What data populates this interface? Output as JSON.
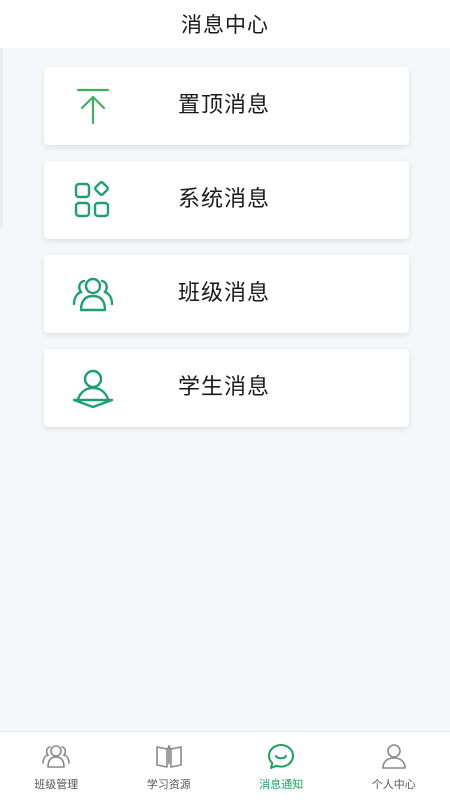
{
  "header": {
    "title": "消息中心"
  },
  "theme": {
    "accent": "#1aa35d",
    "icon_green": "#23a86a",
    "inactive": "#8a8a8a"
  },
  "messages": [
    {
      "label": "置顶消息",
      "icon": "pin-top-icon"
    },
    {
      "label": "系统消息",
      "icon": "apps-grid-icon"
    },
    {
      "label": "班级消息",
      "icon": "group-icon"
    },
    {
      "label": "学生消息",
      "icon": "student-icon"
    }
  ],
  "tabbar": {
    "active_index": 2,
    "items": [
      {
        "label": "班级管理",
        "icon": "class-group-icon"
      },
      {
        "label": "学习资源",
        "icon": "book-icon"
      },
      {
        "label": "消息通知",
        "icon": "chat-bubble-icon"
      },
      {
        "label": "个人中心",
        "icon": "person-icon"
      }
    ]
  }
}
